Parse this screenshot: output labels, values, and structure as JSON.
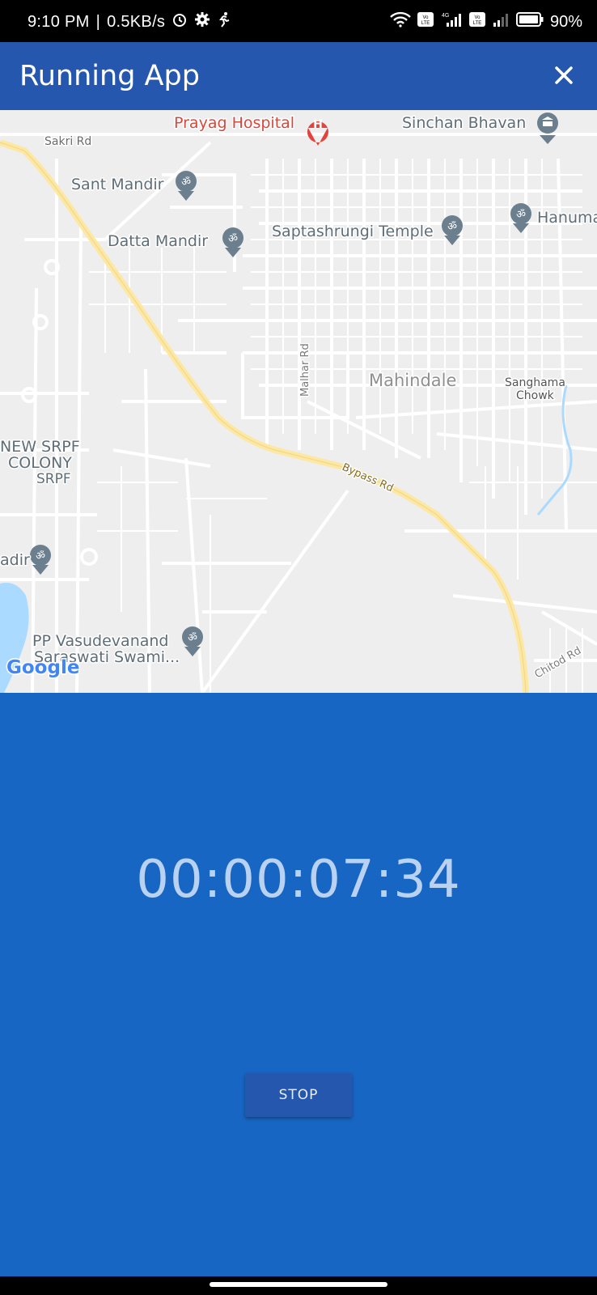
{
  "status_bar": {
    "time": "9:10 PM",
    "speed": "0.5KB/s",
    "battery": "90%",
    "icons": [
      "alarm-icon",
      "settings-icon",
      "running-icon",
      "wifi-icon",
      "volte-icon",
      "signal-icon",
      "battery-icon"
    ]
  },
  "appbar": {
    "title": "Running App",
    "close_icon": "close-icon"
  },
  "map": {
    "labels": {
      "sakri_rd": "Sakri Rd",
      "prayag_hospital": "Prayag Hospital",
      "sinchan_bhavan": "Sinchan Bhavan",
      "sant_mandir": "Sant Mandir",
      "datta_mandir": "Datta Mandir",
      "saptashrungi_temple": "Saptashrungi Temple",
      "hanuma": "Hanuma",
      "malhar_rd": "Malhar Rd",
      "mahindale": "Mahindale",
      "sanghama_chowk_1": "Sanghama",
      "sanghama_chowk_2": "Chowk",
      "new_srpf_1": "NEW SRPF",
      "new_srpf_2": "COLONY",
      "new_srpf_3": "SRPF",
      "bypass_rd": "Bypass Rd",
      "adir": "adir",
      "vasudevanand_1": "PP Vasudevanand",
      "vasudevanand_2": "Saraswati Swami...",
      "chitod_rd": "Chitod Rd",
      "google": "Google"
    },
    "colors": {
      "background": "#eeeeee",
      "road": "#ffffff",
      "highway": "#fce8a4",
      "water": "#aadaff",
      "poi": "#6b7f8f",
      "hospital": "#e3433c"
    }
  },
  "timer": "00:00:07:34",
  "stop_button": "STOP",
  "colors": {
    "appbar": "#2457ad",
    "panel": "#1866c3",
    "timer_text": "#b9d2f1"
  }
}
